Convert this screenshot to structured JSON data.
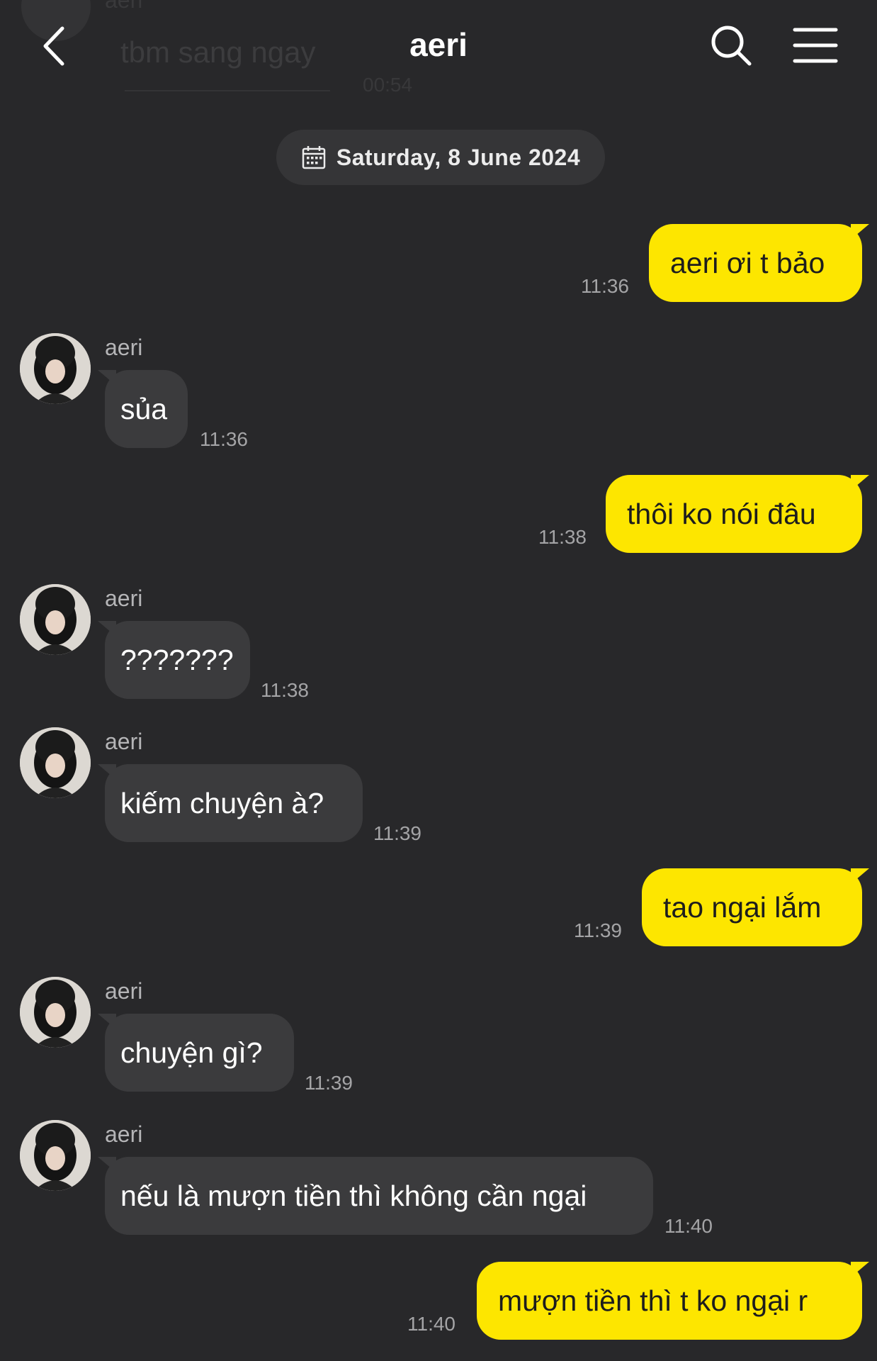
{
  "header": {
    "title": "aeri",
    "ghost_name": "aeri",
    "ghost_message": "tbm sang ngay",
    "ghost_time": "00:54"
  },
  "date_separator": "Saturday, 8 June 2024",
  "messages": [
    {
      "side": "out",
      "text": "aeri ơi t bảo",
      "time": "11:36"
    },
    {
      "side": "in",
      "sender": "aeri",
      "text": "sủa",
      "time": "11:36"
    },
    {
      "side": "out",
      "text": "thôi ko nói đâu",
      "time": "11:38"
    },
    {
      "side": "in",
      "sender": "aeri",
      "text": "???????",
      "time": "11:38"
    },
    {
      "side": "in",
      "sender": "aeri",
      "text": "kiếm chuyện à?",
      "time": "11:39"
    },
    {
      "side": "out",
      "text": "tao ngại lắm",
      "time": "11:39"
    },
    {
      "side": "in",
      "sender": "aeri",
      "text": "chuyện gì?",
      "time": "11:39"
    },
    {
      "side": "in",
      "sender": "aeri",
      "text": "nếu là mượn tiền thì không cần ngại",
      "time": "11:40"
    },
    {
      "side": "out",
      "text": "mượn tiền thì t ko ngại r",
      "time": "11:40"
    }
  ],
  "icons": {
    "back": "chevron-left-icon",
    "search": "search-icon",
    "menu": "hamburger-menu-icon",
    "date": "calendar-icon"
  },
  "colors": {
    "background": "#28282a",
    "outgoing_bubble": "#fde600",
    "incoming_bubble": "#3b3b3d"
  }
}
